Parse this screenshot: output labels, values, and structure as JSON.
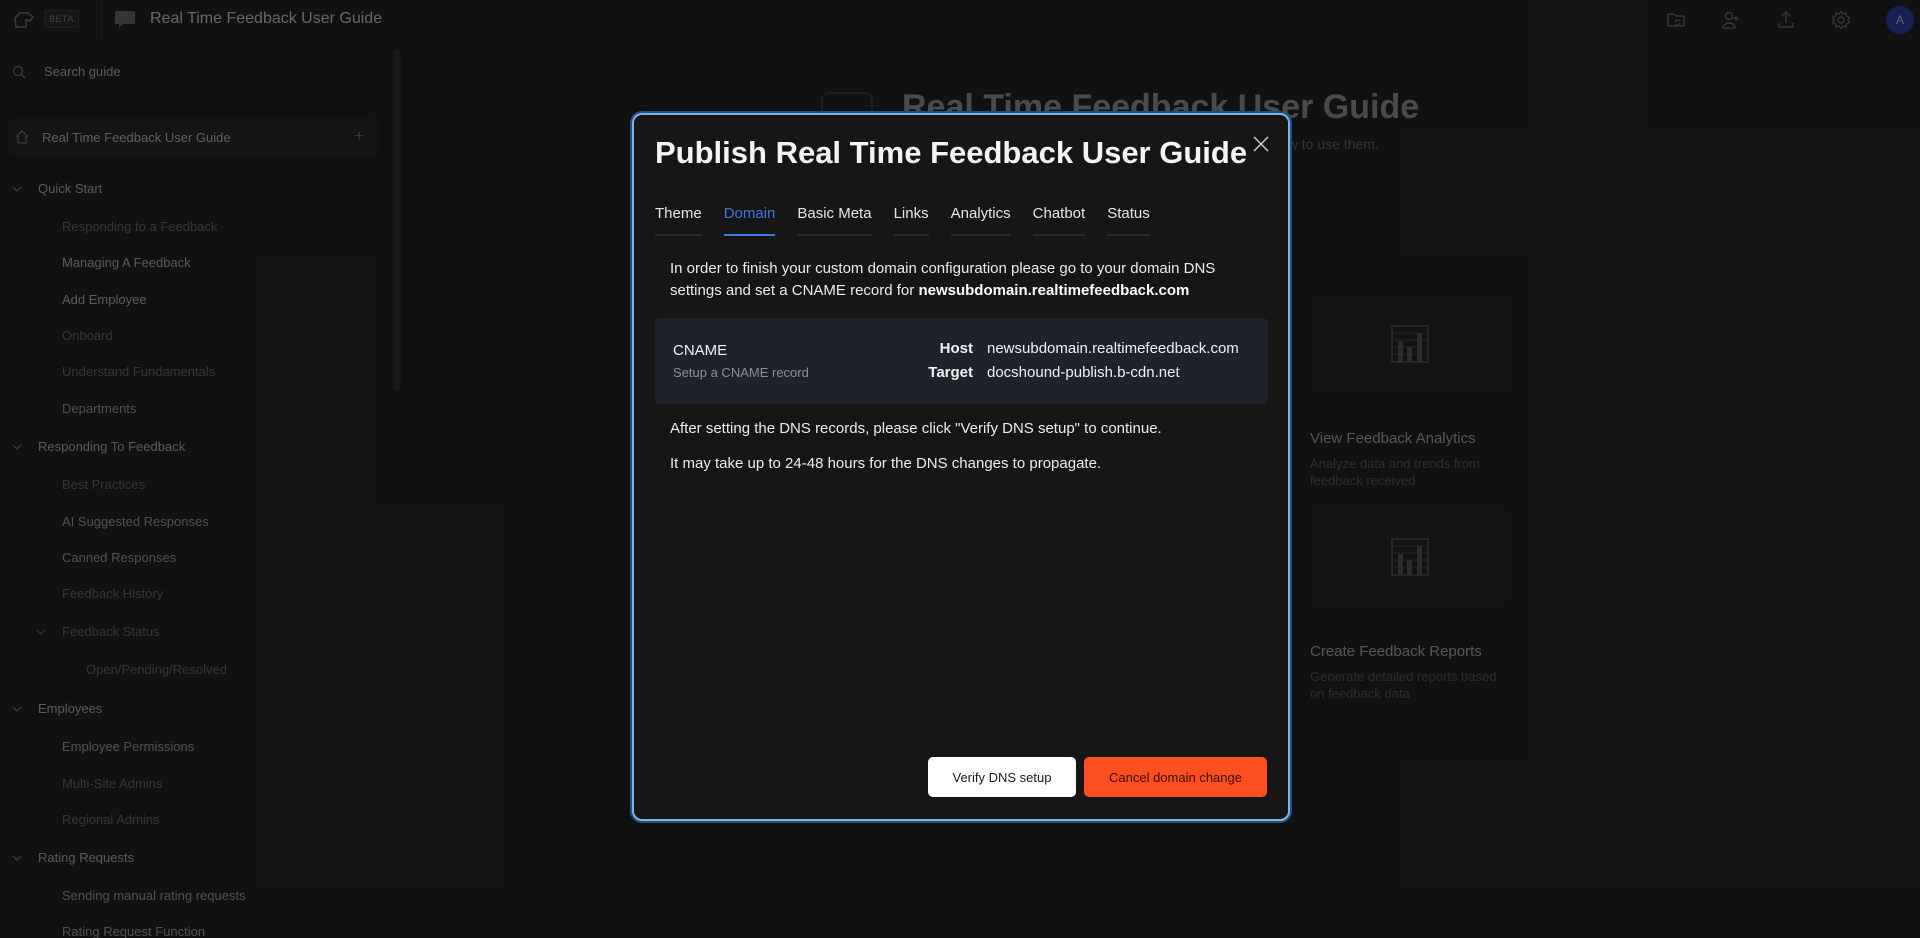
{
  "topbar": {
    "beta_label": "BETA",
    "doc_title": "Real Time Feedback User Guide",
    "icons": [
      "folder-sync-icon",
      "add-user-icon",
      "upload-icon",
      "settings-icon"
    ],
    "avatar_initial": "A",
    "avatar_color": "#2a3aa8"
  },
  "sidebar": {
    "search_placeholder": "Search guide",
    "root_label": "Real Time Feedback User Guide",
    "sections": [
      {
        "label": "Quick Start",
        "items": [
          "Responding to a Feedback",
          "Managing A Feedback",
          "Add Employee",
          "Onboard",
          "Understand Fundamentals",
          "Departments"
        ]
      },
      {
        "label": "Responding To Feedback",
        "items": [
          "Best Practices",
          "AI Suggested Responses",
          "Canned Responses",
          "Feedback History"
        ],
        "subsection": {
          "label": "Feedback Status",
          "items": [
            "Open/Pending/Resolved"
          ]
        }
      },
      {
        "label": "Employees",
        "items": [
          "Employee Permissions",
          "Multi-Site Admins",
          "Regional Admins"
        ]
      },
      {
        "label": "Rating Requests",
        "items": [
          "Sending manual rating requests",
          "Rating Request Function"
        ]
      }
    ]
  },
  "main": {
    "title": "Real Time Feedback User Guide",
    "subtitle_visible": "ow to use them.",
    "cards": [
      {
        "title": "View Feedback Analytics",
        "desc": "Analyze data and trends from feedback received"
      },
      {
        "title": "Create Feedback Reports",
        "desc": "Generate detailed reports based on feedback data"
      }
    ]
  },
  "modal": {
    "title": "Publish Real Time Feedback User Guide",
    "tabs": [
      "Theme",
      "Domain",
      "Basic Meta",
      "Links",
      "Analytics",
      "Chatbot",
      "Status"
    ],
    "active_tab": "Domain",
    "intro_text": "In order to finish your custom domain configuration please go to your domain DNS settings and set a CNAME record for ",
    "intro_domain": "newsubdomain.realtimefeedback.com",
    "record": {
      "type": "CNAME",
      "hint": "Setup a CNAME record",
      "host_label": "Host",
      "host_value": "newsubdomain.realtimefeedback.com",
      "target_label": "Target",
      "target_value": "docshound-publish.b-cdn.net"
    },
    "after_text": "After setting the DNS records, please click \"Verify DNS setup\" to continue.",
    "propagate_text": "It may take up to 24-48 hours for the DNS changes to propagate.",
    "verify_label": "Verify DNS setup",
    "cancel_label": "Cancel domain change",
    "accent_color": "#3c76e0",
    "cancel_color": "#fd4f20"
  }
}
